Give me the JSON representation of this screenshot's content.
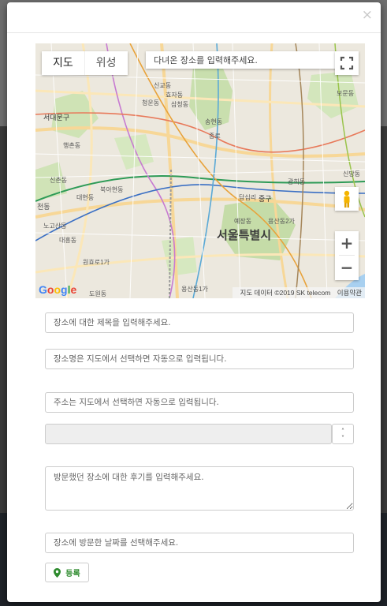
{
  "modal": {
    "close_label": "×"
  },
  "map": {
    "type_map_label": "지도",
    "type_satellite_label": "위성",
    "search_placeholder": "다녀온 장소를 입력해주세요.",
    "city_label": "서울특별시",
    "attribution_data": "지도 데이터 ©2019 SK telecom",
    "attribution_terms": "이용약관",
    "google_logo": "Google",
    "zoom_in": "+",
    "zoom_out": "−",
    "district_labels": [
      "신교동",
      "효자동",
      "청운동",
      "삼청동",
      "송현동",
      "서대문구",
      "종로",
      "행촌동",
      "신촌동",
      "북아현동",
      "대현동",
      "천동",
      "노고산동",
      "대흥동",
      "중구",
      "광희동",
      "답십리",
      "예장동",
      "용산동2가",
      "도원동",
      "용산동1가",
      "원효로1가",
      "보문동",
      "신당동"
    ],
    "fullscreen_icon": "fullscreen-icon",
    "pegman_icon": "pegman-icon"
  },
  "form": {
    "title_placeholder": "장소에 대한 제목을 입력해주세요.",
    "place_name_placeholder": "장소명은 지도에서 선택하면 자동으로 입력됩니다.",
    "address_placeholder": "주소는 지도에서 선택하면 자동으로 입력됩니다.",
    "number_value": "",
    "review_placeholder": "방문했던 장소에 대한 후기를 입력해주세요.",
    "date_placeholder": "장소에 방문한 날짜를 선택해주세요.",
    "register_label": "등록"
  },
  "colors": {
    "accent_green": "#2e8b2e",
    "map_background": "#eae6dc"
  }
}
